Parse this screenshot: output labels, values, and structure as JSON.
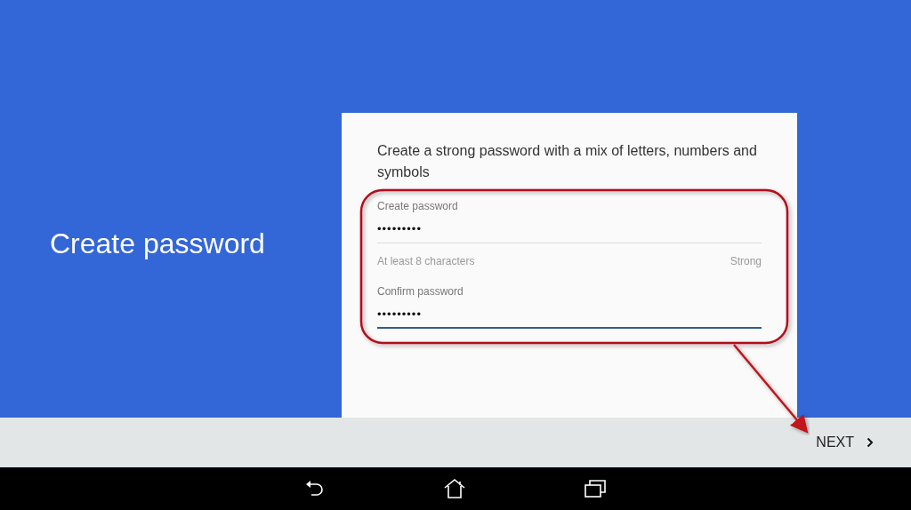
{
  "title": "Create password",
  "card": {
    "description": "Create a strong password with a mix of letters, numbers and symbols",
    "fields": [
      {
        "label": "Create password",
        "value": "•••••••••",
        "focused": false,
        "helper": "At least 8 characters",
        "strength": "Strong"
      },
      {
        "label": "Confirm password",
        "value": "•••••••••",
        "focused": true
      }
    ]
  },
  "next_button": {
    "label": "NEXT"
  }
}
